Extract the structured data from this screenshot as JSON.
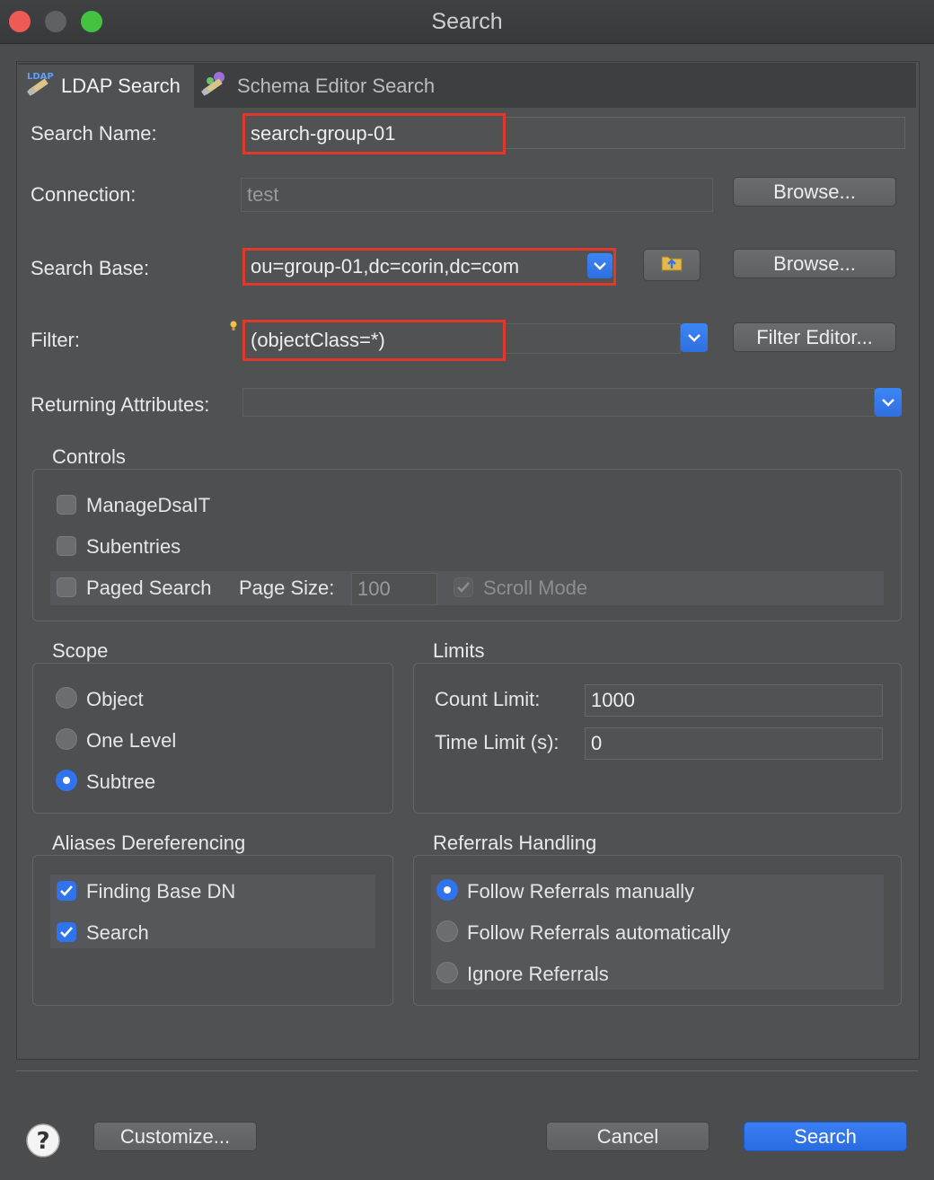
{
  "window": {
    "title": "Search"
  },
  "tabs": [
    {
      "label": "LDAP Search",
      "icon": "ldap-search-icon"
    },
    {
      "label": "Schema Editor Search",
      "icon": "schema-search-icon"
    }
  ],
  "form": {
    "search_name_label": "Search Name:",
    "search_name_value": "search-group-01",
    "connection_label": "Connection:",
    "connection_value": "test",
    "browse_label": "Browse...",
    "search_base_label": "Search Base:",
    "search_base_value": "ou=group-01,dc=corin,dc=com",
    "filter_label": "Filter:",
    "filter_value": "(objectClass=*)",
    "filter_editor_label": "Filter Editor...",
    "returning_attributes_label": "Returning Attributes:",
    "returning_attributes_value": ""
  },
  "controls": {
    "title": "Controls",
    "manage_dsait": {
      "label": "ManageDsaIT",
      "checked": false
    },
    "subentries": {
      "label": "Subentries",
      "checked": false
    },
    "paged_search": {
      "label": "Paged Search",
      "checked": false
    },
    "page_size_label": "Page Size:",
    "page_size_value": "100",
    "scroll_mode": {
      "label": "Scroll Mode",
      "checked": true,
      "disabled": true
    }
  },
  "scope": {
    "title": "Scope",
    "options": [
      "Object",
      "One Level",
      "Subtree"
    ],
    "selected": "Subtree"
  },
  "limits": {
    "title": "Limits",
    "count_limit_label": "Count Limit:",
    "count_limit_value": "1000",
    "time_limit_label": "Time Limit (s):",
    "time_limit_value": "0"
  },
  "aliases": {
    "title": "Aliases Dereferencing",
    "finding_base_dn": {
      "label": "Finding Base DN",
      "checked": true
    },
    "search": {
      "label": "Search",
      "checked": true
    }
  },
  "referrals": {
    "title": "Referrals Handling",
    "options": [
      "Follow Referrals manually",
      "Follow Referrals automatically",
      "Ignore Referrals"
    ],
    "selected": "Follow Referrals manually"
  },
  "footer": {
    "help_icon": "help-icon",
    "customize_label": "Customize...",
    "cancel_label": "Cancel",
    "search_label": "Search"
  },
  "colors": {
    "accent": "#2f74ec",
    "highlight_border": "#e0382a",
    "background": "#4a4c4e"
  }
}
